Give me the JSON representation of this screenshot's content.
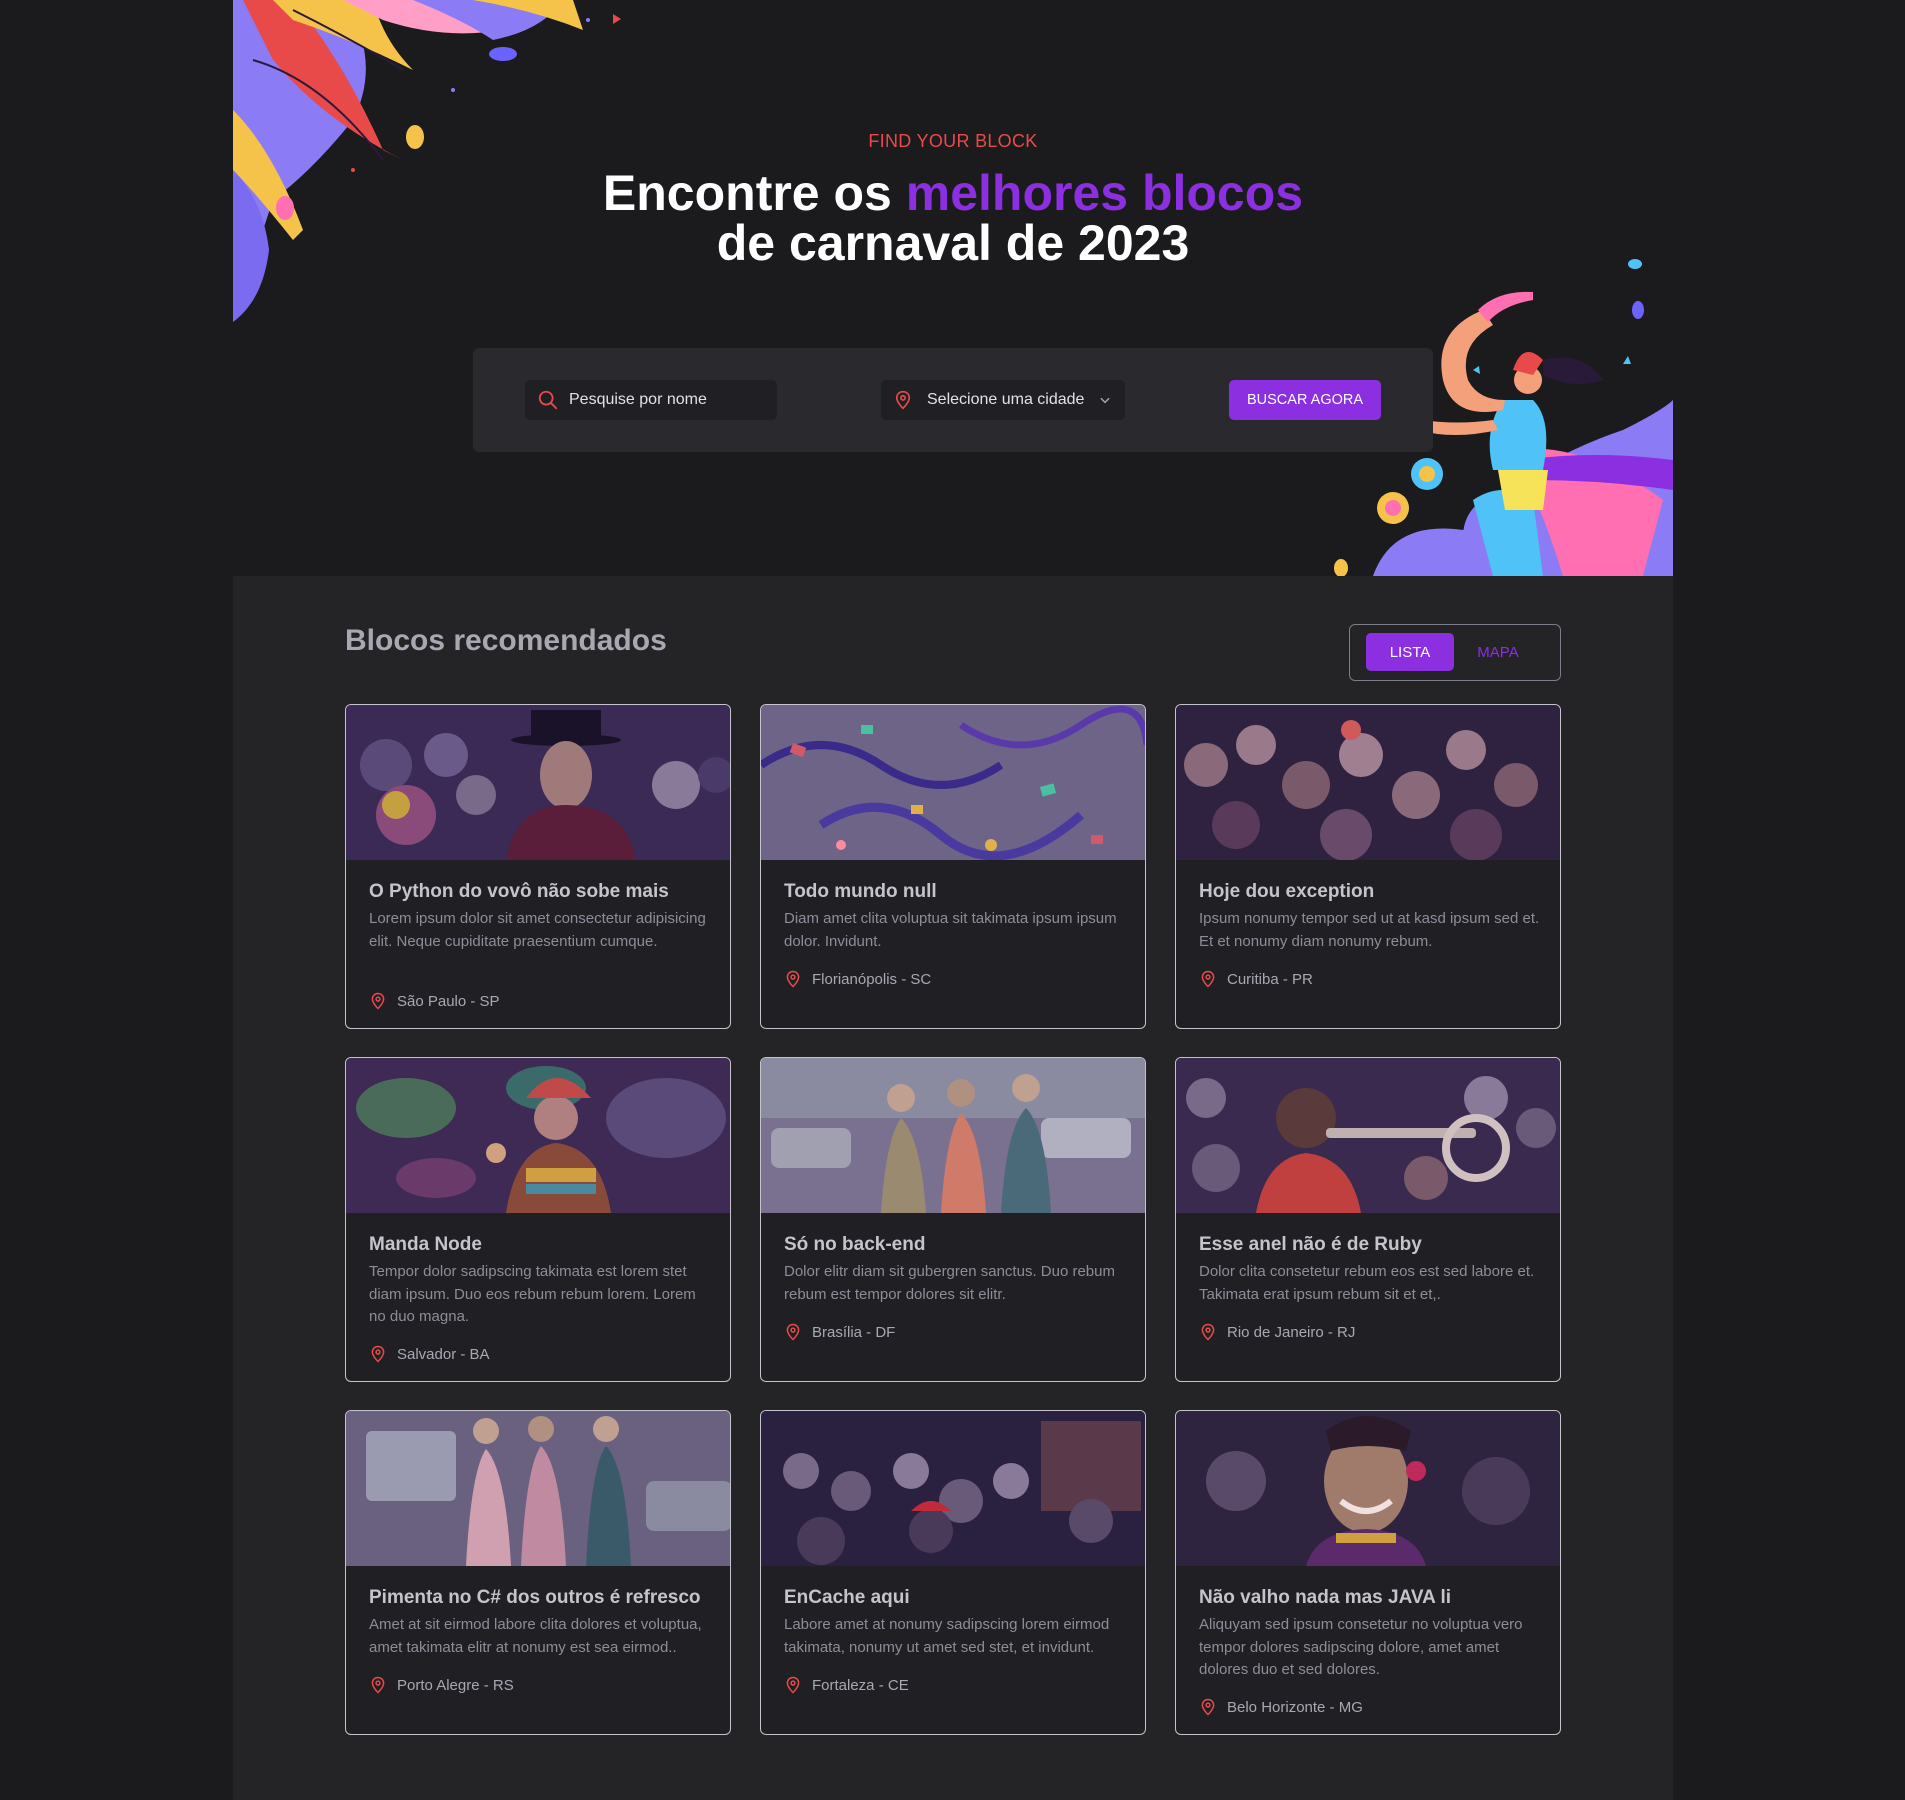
{
  "hero": {
    "eyebrow": "FIND YOUR BLOCK",
    "title_part1": "Encontre os ",
    "title_highlight": "melhores blocos",
    "title_part2": "de carnaval de 2023"
  },
  "search": {
    "placeholder": "Pesquise por nome",
    "city_placeholder": "Selecione uma cidade",
    "button_label": "BUSCAR AGORA"
  },
  "section": {
    "title": "Blocos recomendados",
    "view_list": "LISTA",
    "view_map": "MAPA",
    "active_view": "LISTA"
  },
  "colors": {
    "accent": "#8b2fe0",
    "eyebrow": "#e84a4a",
    "pin": "#e84a4a",
    "background": "#1b1b1e"
  },
  "icons": {
    "search": "search-icon",
    "location": "map-pin-icon",
    "dropdown": "chevron-down-icon"
  },
  "cards": [
    {
      "title": "O Python do vovô não sobe mais",
      "description": "Lorem ipsum dolor sit amet consectetur adipisicing elit. Neque cupiditate praesentium cumque.",
      "location": "São Paulo - SP"
    },
    {
      "title": "Todo mundo null",
      "description": "Diam amet clita voluptua sit takimata ipsum ipsum dolor. Invidunt.",
      "location": "Florianópolis - SC"
    },
    {
      "title": "Hoje dou exception",
      "description": "Ipsum nonumy tempor sed ut at kasd ipsum sed et. Et et nonumy diam nonumy rebum.",
      "location": "Curitiba - PR"
    },
    {
      "title": "Manda Node",
      "description": "Tempor dolor sadipscing takimata est lorem stet diam ipsum. Duo eos rebum rebum lorem. Lorem no duo magna.",
      "location": "Salvador - BA"
    },
    {
      "title": "Só no back-end",
      "description": "Dolor elitr diam sit gubergren sanctus. Duo rebum rebum est tempor dolores sit elitr.",
      "location": "Brasília - DF"
    },
    {
      "title": "Esse anel não é de Ruby",
      "description": "Dolor clita consetetur rebum eos est sed labore et. Takimata erat ipsum rebum sit et et,.",
      "location": "Rio de Janeiro - RJ"
    },
    {
      "title": "Pimenta no C# dos outros é refresco",
      "description": "Amet at sit eirmod labore clita dolores et voluptua, amet takimata elitr at nonumy est sea eirmod..",
      "location": "Porto Alegre - RS"
    },
    {
      "title": "EnCache aqui",
      "description": "Labore amet at nonumy sadipscing lorem eirmod takimata, nonumy ut amet sed stet, et invidunt.",
      "location": "Fortaleza - CE"
    },
    {
      "title": "Não valho nada mas JAVA li",
      "description": "Aliquyam sed ipsum consetetur no voluptua vero tempor dolores sadipscing dolore, amet amet dolores duo et sed dolores.",
      "location": "Belo Horizonte - MG"
    }
  ]
}
